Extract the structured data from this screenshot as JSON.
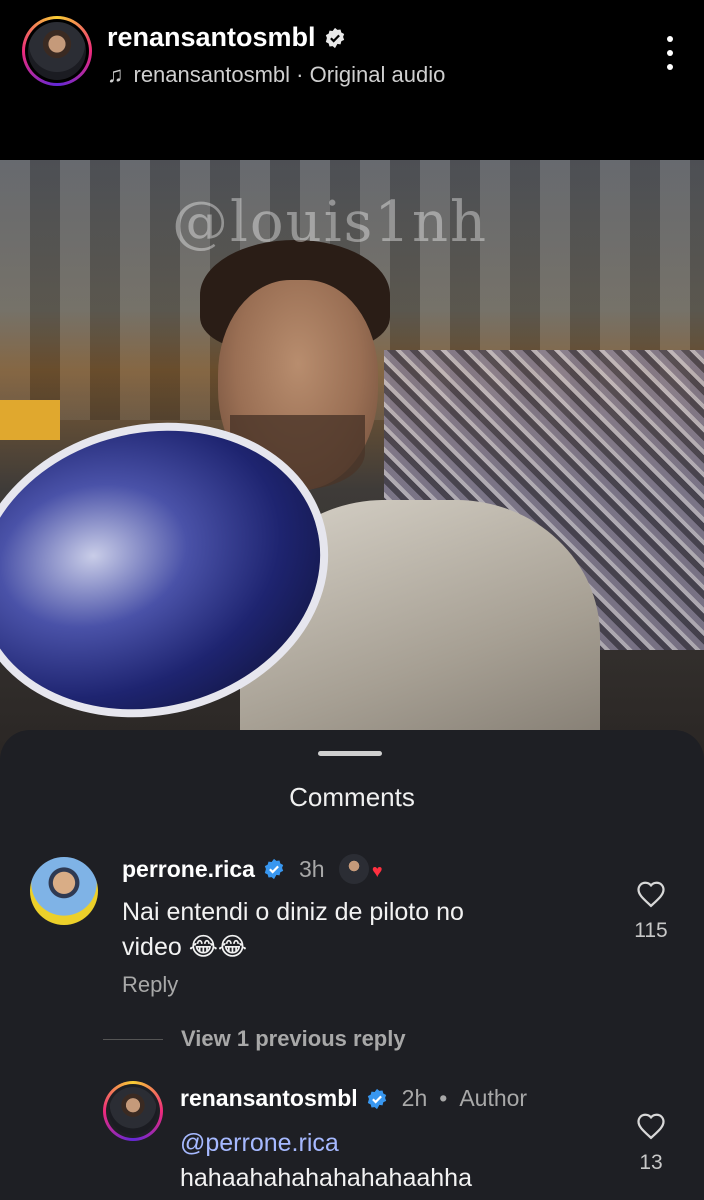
{
  "header": {
    "username": "renansantosmbl",
    "audio_label": "renansantosmbl · Original audio"
  },
  "video": {
    "watermark": "@louis1nh"
  },
  "comments_sheet": {
    "title": "Comments",
    "comments": [
      {
        "username": "perrone.rica",
        "time": "3h",
        "text_line1": "Nai entendi o diniz de piloto no",
        "text_line2": "video 😂😂",
        "reply_label": "Reply",
        "likes": "115"
      }
    ],
    "view_replies_label": "View 1 previous reply",
    "reply": {
      "username": "renansantosmbl",
      "time": "2h",
      "author_label": "Author",
      "mention": "@perrone.rica",
      "text": "hahaahahahahahahaahha",
      "likes": "13"
    }
  },
  "colors": {
    "accent_verified": "#3897f0",
    "like_heart": "#ff3040",
    "mention": "#a6b9ff"
  }
}
